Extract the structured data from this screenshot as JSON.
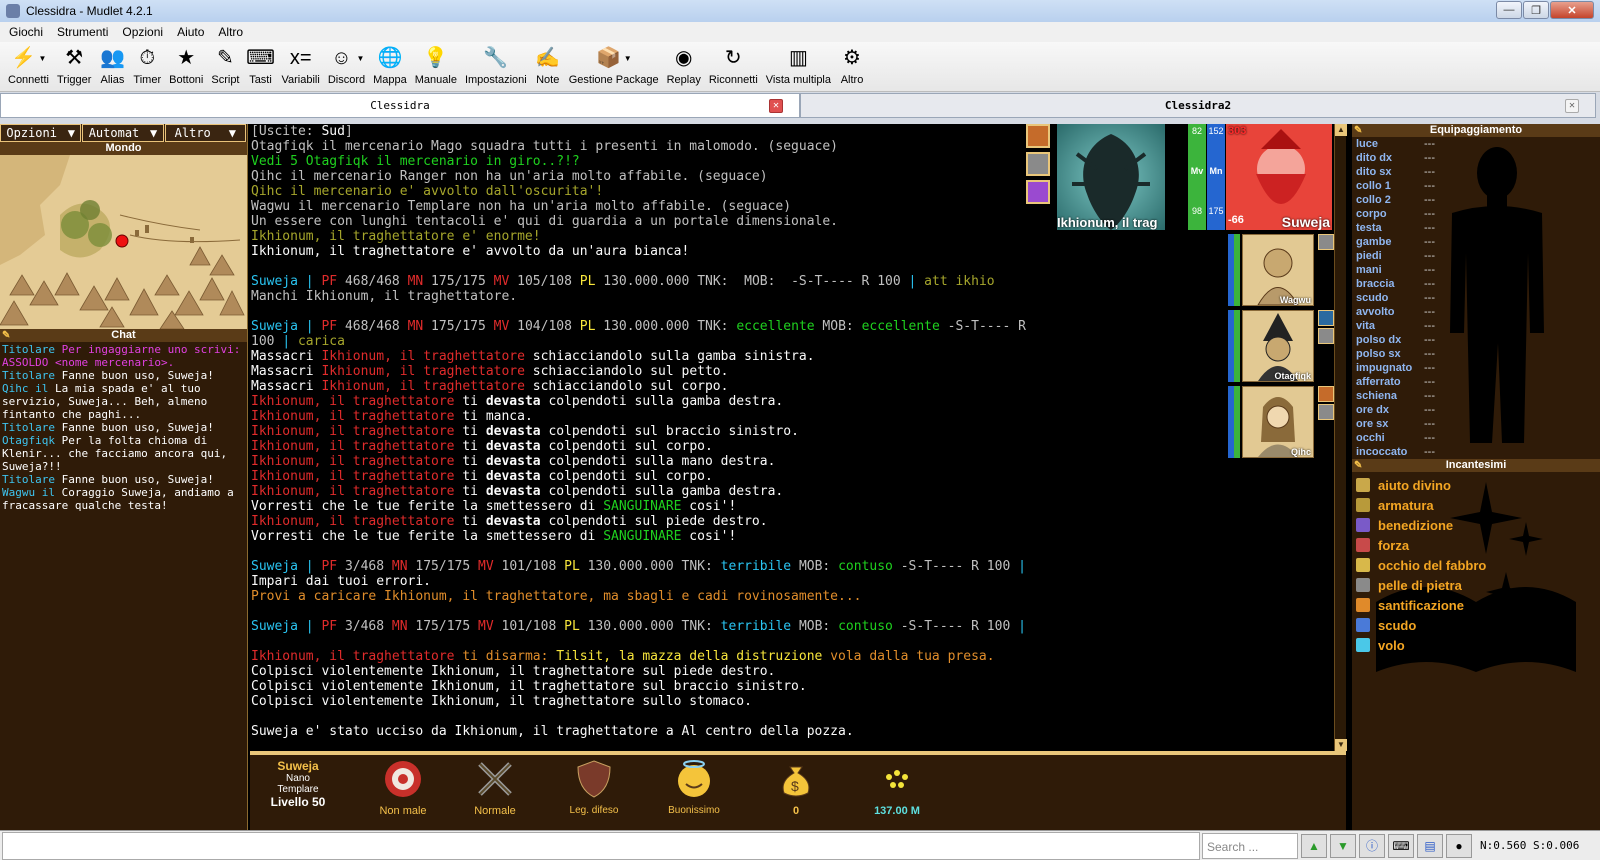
{
  "window": {
    "title": "Clessidra - Mudlet 4.2.1",
    "minimize": "—",
    "maximize": "❐",
    "close": "✕"
  },
  "menu": [
    "Giochi",
    "Strumenti",
    "Opzioni",
    "Aiuto",
    "Altro"
  ],
  "toolbar": [
    {
      "label": "Connetti",
      "icon": "connect-icon",
      "glyph": "⚡",
      "dd": true
    },
    {
      "label": "Trigger",
      "icon": "trigger-icon",
      "glyph": "⚒",
      "dd": false
    },
    {
      "label": "Alias",
      "icon": "alias-icon",
      "glyph": "👥",
      "dd": false
    },
    {
      "label": "Timer",
      "icon": "timer-icon",
      "glyph": "⏱",
      "dd": false
    },
    {
      "label": "Bottoni",
      "icon": "buttons-icon",
      "glyph": "★",
      "dd": false
    },
    {
      "label": "Script",
      "icon": "script-icon",
      "glyph": "✎",
      "dd": false
    },
    {
      "label": "Tasti",
      "icon": "keys-icon",
      "glyph": "⌨",
      "dd": false
    },
    {
      "label": "Variabili",
      "icon": "variables-icon",
      "glyph": "x=",
      "dd": false
    },
    {
      "label": "Discord",
      "icon": "discord-icon",
      "glyph": "☺",
      "dd": true
    },
    {
      "label": "Mappa",
      "icon": "map-icon",
      "glyph": "🌐",
      "dd": false
    },
    {
      "label": "Manuale",
      "icon": "manual-icon",
      "glyph": "💡",
      "dd": false
    },
    {
      "label": "Impostazioni",
      "icon": "settings-icon",
      "glyph": "🔧",
      "dd": false
    },
    {
      "label": "Note",
      "icon": "notes-icon",
      "glyph": "✍",
      "dd": false
    },
    {
      "label": "Gestione Package",
      "icon": "package-icon",
      "glyph": "📦",
      "dd": true
    },
    {
      "label": "Replay",
      "icon": "replay-icon",
      "glyph": "◉",
      "dd": false
    },
    {
      "label": "Riconnetti",
      "icon": "reconnect-icon",
      "glyph": "↻",
      "dd": false
    },
    {
      "label": "Vista multipla",
      "icon": "multiview-icon",
      "glyph": "▥",
      "dd": false
    },
    {
      "label": "Altro",
      "icon": "more-icon",
      "glyph": "⚙",
      "dd": false
    }
  ],
  "tabs": [
    {
      "label": "Clessidra",
      "active": true
    },
    {
      "label": "Clessidra2",
      "active": false
    }
  ],
  "tab_close": "✕",
  "left": {
    "opts": [
      {
        "label": "Opzioni"
      },
      {
        "label": "Automat"
      },
      {
        "label": "Altro"
      }
    ],
    "dd_arrow": "▼",
    "pin": "✎",
    "mondo": "Mondo",
    "chat_title": "Chat",
    "chat": [
      {
        "who": "Titolare",
        "text": " Per ingaggiarne uno scrivi: ASSOLDO <nome mercenario>.",
        "mag": true
      },
      {
        "who": "Titolare",
        "text": " Fanne buon uso, Suweja!",
        "mag": false
      },
      {
        "who": "Qihc il",
        "text": "  La mia spada e' al tuo servizio, Suweja... Beh, almeno fintanto che paghi...",
        "mag": false
      },
      {
        "who": "Titolare",
        "text": " Fanne buon uso, Suweja!",
        "mag": false
      },
      {
        "who": "Otagfiqk",
        "text": " Per la folta chioma di Klenir... che facciamo ancora qui, Suweja?!!",
        "mag": false
      },
      {
        "who": "Titolare",
        "text": " Fanne buon uso, Suweja!",
        "mag": false
      },
      {
        "who": "Wagwu il",
        "text": " Coraggio Suweja, andiamo a fracassare qualche testa!",
        "mag": false
      }
    ]
  },
  "output": [
    [
      [
        "[Uscite: ",
        "g"
      ],
      [
        "Sud",
        "w"
      ],
      [
        "]",
        "g"
      ]
    ],
    [
      [
        "Otagfiqk il mercenario Mago squadra tutti i presenti in malomodo. (seguace)",
        "g"
      ]
    ],
    [
      [
        "Vedi 5 Otagfiqk il mercenario in giro..?!?",
        "gr"
      ]
    ],
    [
      [
        "Qihc il mercenario Ranger non ha un'aria molto affabile. (seguace)",
        "g"
      ]
    ],
    [
      [
        "Qihc il mercenario e' avvolto dall'oscurita'!",
        "ol"
      ]
    ],
    [
      [
        "Wagwu il mercenario Templare non ha un'aria molto affabile. (seguace)",
        "g"
      ]
    ],
    [
      [
        "Un essere con lunghi tentacoli e' qui di guardia a un portale dimensionale.",
        "g"
      ]
    ],
    [
      [
        "Ikhionum, il traghettatore e' enorme!",
        "ol"
      ]
    ],
    [
      [
        "Ikhionum, il traghettatore e' avvolto da un'aura bianca!",
        "w"
      ]
    ],
    [],
    [
      [
        "Suweja",
        "cy"
      ],
      [
        " | ",
        "cy"
      ],
      [
        "PF ",
        "r"
      ],
      [
        "468/468 ",
        "g"
      ],
      [
        "MN ",
        "r"
      ],
      [
        "175/175 ",
        "g"
      ],
      [
        "MV ",
        "r"
      ],
      [
        "105/108 ",
        "g"
      ],
      [
        "PL ",
        "yb"
      ],
      [
        "130.000.000 ",
        "g"
      ],
      [
        "TNK:  MOB:  -S-T---- R 100 ",
        "g"
      ],
      [
        "| ",
        "cy"
      ],
      [
        "att ikhio",
        "ol"
      ]
    ],
    [
      [
        "Manchi Ikhionum, il traghettatore.",
        "g"
      ]
    ],
    [],
    [
      [
        "Suweja",
        "cy"
      ],
      [
        " | ",
        "cy"
      ],
      [
        "PF ",
        "r"
      ],
      [
        "468/468 ",
        "g"
      ],
      [
        "MN ",
        "r"
      ],
      [
        "175/175 ",
        "g"
      ],
      [
        "MV ",
        "r"
      ],
      [
        "104/108 ",
        "g"
      ],
      [
        "PL ",
        "yb"
      ],
      [
        "130.000.000 ",
        "g"
      ],
      [
        "TNK: ",
        "g"
      ],
      [
        "eccellente ",
        "gr"
      ],
      [
        "MOB: ",
        "g"
      ],
      [
        "eccellente ",
        "gr"
      ],
      [
        "-S-T---- R",
        "g"
      ]
    ],
    [
      [
        "100 ",
        "g"
      ],
      [
        "| ",
        "cy"
      ],
      [
        "carica",
        "ol"
      ]
    ],
    [
      [
        "Massacri ",
        "w"
      ],
      [
        "Ikhionum, il traghettatore ",
        "r"
      ],
      [
        "schiacciandolo sulla gamba sinistra.",
        "w"
      ]
    ],
    [
      [
        "Massacri ",
        "w"
      ],
      [
        "Ikhionum, il traghettatore ",
        "r"
      ],
      [
        "schiacciandolo sul petto.",
        "w"
      ]
    ],
    [
      [
        "Massacri ",
        "w"
      ],
      [
        "Ikhionum, il traghettatore ",
        "r"
      ],
      [
        "schiacciandolo sul corpo.",
        "w"
      ]
    ],
    [
      [
        "Ikhionum, il traghettatore ",
        "r"
      ],
      [
        "ti ",
        "w"
      ],
      [
        "devasta ",
        "wb"
      ],
      [
        "colpendoti sulla gamba destra.",
        "w"
      ]
    ],
    [
      [
        "Ikhionum, il traghettatore ",
        "r"
      ],
      [
        "ti ",
        "w"
      ],
      [
        "manca.",
        "w"
      ]
    ],
    [
      [
        "Ikhionum, il traghettatore ",
        "r"
      ],
      [
        "ti ",
        "w"
      ],
      [
        "devasta ",
        "wb"
      ],
      [
        "colpendoti sul braccio sinistro.",
        "w"
      ]
    ],
    [
      [
        "Ikhionum, il traghettatore ",
        "r"
      ],
      [
        "ti ",
        "w"
      ],
      [
        "devasta ",
        "wb"
      ],
      [
        "colpendoti sul corpo.",
        "w"
      ]
    ],
    [
      [
        "Ikhionum, il traghettatore ",
        "r"
      ],
      [
        "ti ",
        "w"
      ],
      [
        "devasta ",
        "wb"
      ],
      [
        "colpendoti sulla mano destra.",
        "w"
      ]
    ],
    [
      [
        "Ikhionum, il traghettatore ",
        "r"
      ],
      [
        "ti ",
        "w"
      ],
      [
        "devasta ",
        "wb"
      ],
      [
        "colpendoti sul corpo.",
        "w"
      ]
    ],
    [
      [
        "Ikhionum, il traghettatore ",
        "r"
      ],
      [
        "ti ",
        "w"
      ],
      [
        "devasta ",
        "wb"
      ],
      [
        "colpendoti sulla gamba destra.",
        "w"
      ]
    ],
    [
      [
        "Vorresti che le tue ferite la smettessero di ",
        "w"
      ],
      [
        "SANGUINARE",
        "gr"
      ],
      [
        " cosi'!",
        "w"
      ]
    ],
    [
      [
        "Ikhionum, il traghettatore ",
        "r"
      ],
      [
        "ti ",
        "w"
      ],
      [
        "devasta ",
        "wb"
      ],
      [
        "colpendoti sul piede destro.",
        "w"
      ]
    ],
    [
      [
        "Vorresti che le tue ferite la smettessero di ",
        "w"
      ],
      [
        "SANGUINARE",
        "gr"
      ],
      [
        " cosi'!",
        "w"
      ]
    ],
    [],
    [
      [
        "Suweja",
        "cy"
      ],
      [
        " | ",
        "cy"
      ],
      [
        "PF ",
        "r"
      ],
      [
        "3/468 ",
        "g"
      ],
      [
        "MN ",
        "r"
      ],
      [
        "175/175 ",
        "g"
      ],
      [
        "MV ",
        "r"
      ],
      [
        "101/108 ",
        "g"
      ],
      [
        "PL ",
        "yb"
      ],
      [
        "130.000.000 ",
        "g"
      ],
      [
        "TNK: ",
        "g"
      ],
      [
        "terribile ",
        "cy"
      ],
      [
        "MOB: ",
        "g"
      ],
      [
        "contuso ",
        "gr"
      ],
      [
        "-S-T---- R 100 ",
        "g"
      ],
      [
        "|",
        "cy"
      ]
    ],
    [
      [
        "Impari dai tuoi errori.",
        "w"
      ]
    ],
    [
      [
        "Provi a caricare Ikhionum, il traghettatore, ma sbagli e cadi rovinosamente...",
        "or"
      ]
    ],
    [],
    [
      [
        "Suweja",
        "cy"
      ],
      [
        " | ",
        "cy"
      ],
      [
        "PF ",
        "r"
      ],
      [
        "3/468 ",
        "g"
      ],
      [
        "MN ",
        "r"
      ],
      [
        "175/175 ",
        "g"
      ],
      [
        "MV ",
        "r"
      ],
      [
        "101/108 ",
        "g"
      ],
      [
        "PL ",
        "yb"
      ],
      [
        "130.000.000 ",
        "g"
      ],
      [
        "TNK: ",
        "g"
      ],
      [
        "terribile ",
        "cy"
      ],
      [
        "MOB: ",
        "g"
      ],
      [
        "contuso ",
        "gr"
      ],
      [
        "-S-T---- R 100 ",
        "g"
      ],
      [
        "|",
        "cy"
      ]
    ],
    [],
    [
      [
        "Ikhionum, il traghettatore ",
        "r"
      ],
      [
        "ti disarma: ",
        "or"
      ],
      [
        "Tilsit, la mazza della distruzione ",
        "yb"
      ],
      [
        "vola dalla tua presa.",
        "or"
      ]
    ],
    [
      [
        "Colpisci violentemente Ikhionum, il traghettatore sul piede destro.",
        "w"
      ]
    ],
    [
      [
        "Colpisci violentemente Ikhionum, il traghettatore sul braccio sinistro.",
        "w"
      ]
    ],
    [
      [
        "Colpisci violentemente Ikhionum, il traghettatore sullo stomaco.",
        "w"
      ]
    ],
    [],
    [
      [
        "Suweja e' stato ucciso da Ikhionum, il traghettatore a Al centro della pozza.",
        "w"
      ]
    ]
  ],
  "portraits": {
    "enemy_name": "Ikhionum, il trag",
    "player_name": "Suweja",
    "mv_top": "82",
    "mv_label": "Mv",
    "mv_bottom": "98",
    "mn_top": "152",
    "mn_label": "Mn",
    "mn_bottom": "175",
    "pf_top": "303",
    "pf_bottom": "-66",
    "followers": [
      {
        "name": "Wagwu"
      },
      {
        "name": "Otagfiqk"
      },
      {
        "name": "Qihc"
      }
    ]
  },
  "equipment": {
    "title": "Equipaggiamento",
    "rows": [
      {
        "slot": "luce",
        "value": "---"
      },
      {
        "slot": "dito dx",
        "value": "---"
      },
      {
        "slot": "dito sx",
        "value": "---"
      },
      {
        "slot": "collo 1",
        "value": "---"
      },
      {
        "slot": "collo 2",
        "value": "---"
      },
      {
        "slot": "corpo",
        "value": "---"
      },
      {
        "slot": "testa",
        "value": "---"
      },
      {
        "slot": "gambe",
        "value": "---"
      },
      {
        "slot": "piedi",
        "value": "---"
      },
      {
        "slot": "mani",
        "value": "---"
      },
      {
        "slot": "braccia",
        "value": "---"
      },
      {
        "slot": "scudo",
        "value": "---"
      },
      {
        "slot": "avvolto",
        "value": "---"
      },
      {
        "slot": "vita",
        "value": "---"
      },
      {
        "slot": "polso dx",
        "value": "---"
      },
      {
        "slot": "polso sx",
        "value": "---"
      },
      {
        "slot": "impugnato",
        "value": "---"
      },
      {
        "slot": "afferrato",
        "value": "---"
      },
      {
        "slot": "schiena",
        "value": "---"
      },
      {
        "slot": "ore dx",
        "value": "---"
      },
      {
        "slot": "ore sx",
        "value": "---"
      },
      {
        "slot": "occhi",
        "value": "---"
      },
      {
        "slot": "incoccato",
        "value": "---"
      }
    ]
  },
  "spells": {
    "title": "Incantesimi",
    "items": [
      {
        "name": "aiuto divino",
        "color": "#c9a84a"
      },
      {
        "name": "armatura",
        "color": "#b89a3a"
      },
      {
        "name": "benedizione",
        "color": "#7a5ac8"
      },
      {
        "name": "forza",
        "color": "#c84a4a"
      },
      {
        "name": "occhio del fabbro",
        "color": "#d8b84a"
      },
      {
        "name": "pelle di pietra",
        "color": "#8a8a8a"
      },
      {
        "name": "santificazione",
        "color": "#e08a2a"
      },
      {
        "name": "scudo",
        "color": "#4a7ad8"
      },
      {
        "name": "volo",
        "color": "#4ac8e8"
      }
    ]
  },
  "status": {
    "name": "Suweja",
    "race": "Nano",
    "class": "Templare",
    "level": "Livello 50",
    "health": "Non male",
    "stance": "Normale",
    "defense": "Leg. difeso",
    "mood": "Buonissimo",
    "gold": "0",
    "xp": "137.00 M"
  },
  "cmd": {
    "search_placeholder": "Search ...",
    "netstat": "N:0.560 S:0.006"
  },
  "colors": {
    "accent": "#e9c67a",
    "panel": "#2f1b08",
    "red": "#e02b2b",
    "cyan": "#2ac5f2"
  }
}
